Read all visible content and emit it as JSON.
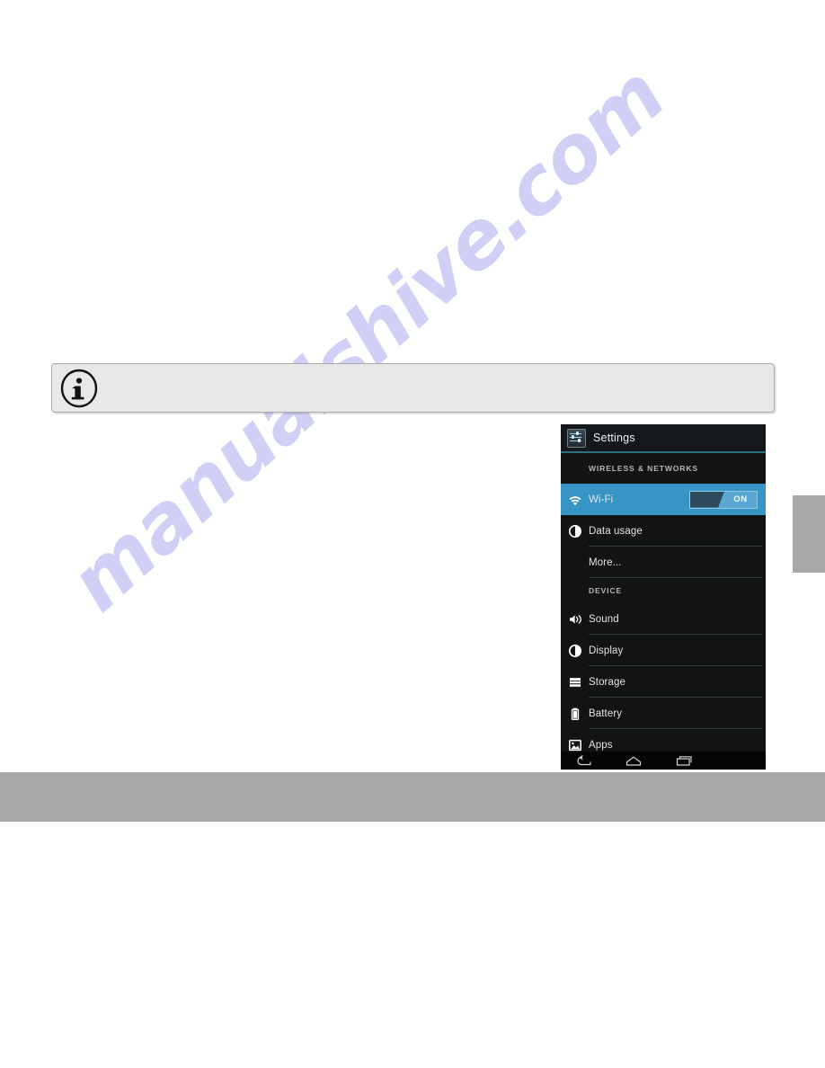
{
  "page": {
    "background_color": "#ffffff",
    "footer_band_color": "#a8a8a8",
    "chapter_tab_color": "#a8a8a8"
  },
  "watermark": {
    "text": "manualshive.com",
    "color": "#9696eb"
  },
  "note_box": {
    "icon": "info-circle-icon",
    "text": "",
    "background_color": "#e8e8e8",
    "border_color": "#a9a9a9"
  },
  "android_screenshot": {
    "header": {
      "app_icon": "settings-sliders-icon",
      "title": "Settings",
      "background_color": "#14181a",
      "accent_line_color": "#2e6f82"
    },
    "sections": [
      {
        "header": "WIRELESS & NETWORKS",
        "items": [
          {
            "label": "Wi-Fi",
            "icon": "wifi-icon",
            "selected": true,
            "toggle": {
              "state": "ON",
              "on": true
            }
          },
          {
            "label": "Data usage",
            "icon": "data-usage-pie-icon",
            "selected": false
          },
          {
            "label": "More...",
            "icon": null,
            "selected": false
          }
        ]
      },
      {
        "header": "DEVICE",
        "items": [
          {
            "label": "Sound",
            "icon": "speaker-icon",
            "selected": false
          },
          {
            "label": "Display",
            "icon": "brightness-icon",
            "selected": false
          },
          {
            "label": "Storage",
            "icon": "storage-bars-icon",
            "selected": false
          },
          {
            "label": "Battery",
            "icon": "battery-icon",
            "selected": false
          },
          {
            "label": "Apps",
            "icon": "apps-image-icon",
            "selected": false
          }
        ]
      }
    ],
    "navbar": {
      "buttons": [
        {
          "name": "back-icon"
        },
        {
          "name": "home-icon"
        },
        {
          "name": "recent-apps-icon"
        }
      ],
      "background_color": "#050506"
    },
    "colors": {
      "selected_row": "#3894c4",
      "body_background": "#111314",
      "divider": "#33383a",
      "label_text": "#e4e4e4",
      "section_text": "#b6b6b6"
    }
  }
}
